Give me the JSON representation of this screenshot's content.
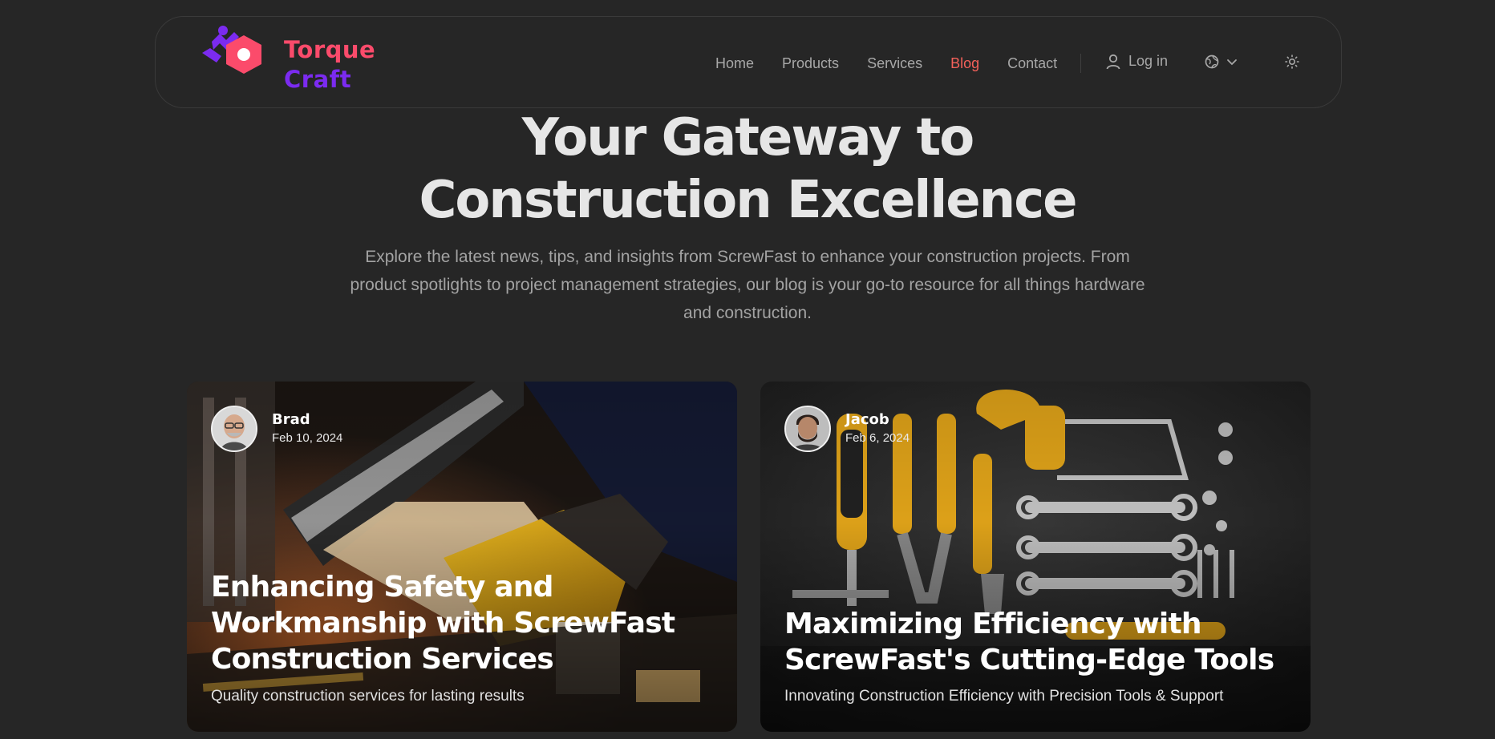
{
  "brand": {
    "name_line1": "Torque",
    "name_line2": "Craft",
    "color_primary": "#fb4b6b",
    "color_secondary": "#7b2bf0"
  },
  "nav": {
    "items": [
      {
        "label": "Home",
        "active": false
      },
      {
        "label": "Products",
        "active": false
      },
      {
        "label": "Services",
        "active": false
      },
      {
        "label": "Blog",
        "active": true
      },
      {
        "label": "Contact",
        "active": false
      }
    ],
    "login_label": "Log in",
    "language_icon": "globe-icon",
    "theme_icon": "sun-icon"
  },
  "hero": {
    "title_line1": "Your Gateway to",
    "title_line2": "Construction Excellence",
    "subtitle": "Explore the latest news, tips, and insights from ScrewFast to enhance your construction projects. From product spotlights to project management strategies, our blog is your go-to resource for all things hardware and construction."
  },
  "posts": [
    {
      "author": "Brad",
      "date": "Feb 10, 2024",
      "title": "Enhancing Safety and Workmanship with ScrewFast Construction Services",
      "subtitle": "Quality construction services for lasting results"
    },
    {
      "author": "Jacob",
      "date": "Feb 6, 2024",
      "title": "Maximizing Efficiency with ScrewFast's Cutting-Edge Tools",
      "subtitle": "Innovating Construction Efficiency with Precision Tools & Support"
    }
  ]
}
